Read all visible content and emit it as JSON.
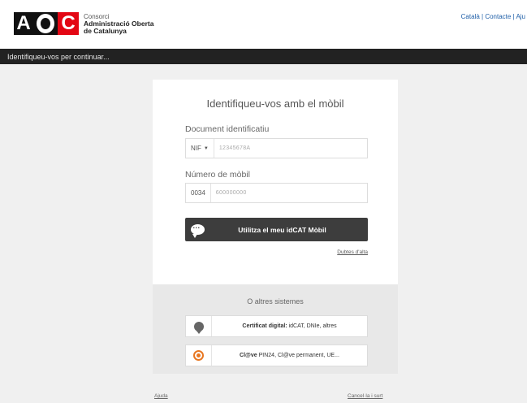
{
  "header": {
    "logo": {
      "letters": [
        "A",
        "O",
        "C"
      ]
    },
    "org_small": "Consorci",
    "org_name_line1": "Administració Oberta",
    "org_name_line2": "de Catalunya",
    "links": [
      "Català",
      "Contacte",
      "Aju"
    ]
  },
  "topbar": {
    "text": "Identifiqueu-vos per continuar..."
  },
  "card": {
    "title": "Identifiqueu-vos amb el mòbil",
    "doc_label": "Document identificatiu",
    "doc_type": "NIF",
    "doc_value": "12345678A",
    "phone_label": "Número de mòbil",
    "phone_prefix": "0034",
    "phone_value": "600000000",
    "submit_label": "Utilitza el meu idCAT Mòbil",
    "help_link": "Dubtes d'alta"
  },
  "other": {
    "title": "O altres sistemes",
    "options": [
      {
        "bold": "Certificat digital:",
        "rest": " idCAT, DNIe, altres",
        "icon": "certificate-badge-icon"
      },
      {
        "bold": "Cl@ve",
        "rest": " PIN24, Cl@ve permanent, UE...",
        "icon": "clave-icon"
      }
    ]
  },
  "footer": {
    "left": "Ajuda",
    "right": "Cancel·la i surt"
  },
  "colors": {
    "brand_red": "#e30613",
    "dark_bar": "#222222",
    "button": "#3d3d3d",
    "clave_orange": "#e87722",
    "link_blue": "#1f5fa8"
  }
}
